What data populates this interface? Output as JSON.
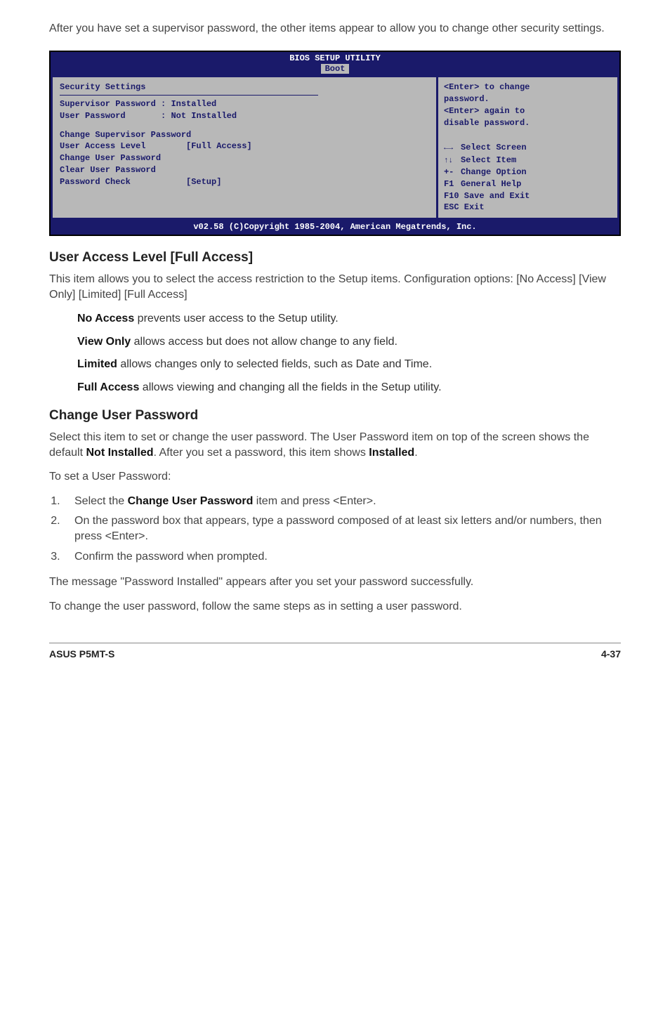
{
  "intro": "After you have set a supervisor password, the other items appear to allow you to change other security settings.",
  "bios": {
    "title": "BIOS SETUP UTILITY",
    "tab": "Boot",
    "section": "Security Settings",
    "rows": [
      {
        "label": "Supervisor Password",
        "sep": " : ",
        "value": "Installed"
      },
      {
        "label": "User Password",
        "sep": "       : ",
        "value": "Not Installed"
      }
    ],
    "items": [
      {
        "label": "Change Supervisor Password",
        "value": ""
      },
      {
        "label": "User Access Level",
        "value": "[Full Access]"
      },
      {
        "label": "Change User Password",
        "value": ""
      },
      {
        "label": "Clear User Password",
        "value": ""
      },
      {
        "label": "Password Check",
        "value": "[Setup]"
      }
    ],
    "help_top": [
      "<Enter> to change",
      "password.",
      "<Enter> again to",
      "disable password."
    ],
    "nav": {
      "lr": "Select Screen",
      "ud": "Select Item",
      "pm": "Change Option",
      "pm_key": "+-",
      "f1": "General Help",
      "f1_key": "F1",
      "f10": "F10 Save and Exit",
      "esc": "ESC Exit"
    },
    "footer": "v02.58 (C)Copyright 1985-2004, American Megatrends, Inc."
  },
  "ual": {
    "heading": "User Access Level [Full Access]",
    "desc": "This item allows you to select the access restriction to the Setup items. Configuration options: [No Access] [View Only] [Limited] [Full Access]",
    "opts": [
      {
        "b": "No Access",
        "t": " prevents user access to the Setup utility."
      },
      {
        "b": "View Only",
        "t": " allows access but does not allow change to any field."
      },
      {
        "b": "Limited",
        "t": " allows changes only to selected fields, such as Date and Time."
      },
      {
        "b": "Full Access",
        "t": " allows viewing and changing all the fields in the Setup utility."
      }
    ]
  },
  "cup": {
    "heading": "Change User Password",
    "p1a": "Select this item to set or change the user password. The User Password item on top of the screen shows the default ",
    "p1b": "Not Installed",
    "p1c": ". After you set a password, this item shows ",
    "p1d": "Installed",
    "p1e": ".",
    "p2": "To set a User Password:",
    "steps": [
      {
        "pre": "Select the ",
        "b": "Change User Password",
        "post": " item and press <Enter>."
      },
      {
        "pre": "On the password box that appears, type a password composed of at least six letters and/or numbers, then press <Enter>.",
        "b": "",
        "post": ""
      },
      {
        "pre": "Confirm the password when prompted.",
        "b": "",
        "post": ""
      }
    ],
    "p3": "The message \"Password Installed\" appears after you set your password successfully.",
    "p4": "To change the user password, follow the same steps as in setting a user password."
  },
  "footer": {
    "left": "ASUS P5MT-S",
    "right": "4-37"
  }
}
